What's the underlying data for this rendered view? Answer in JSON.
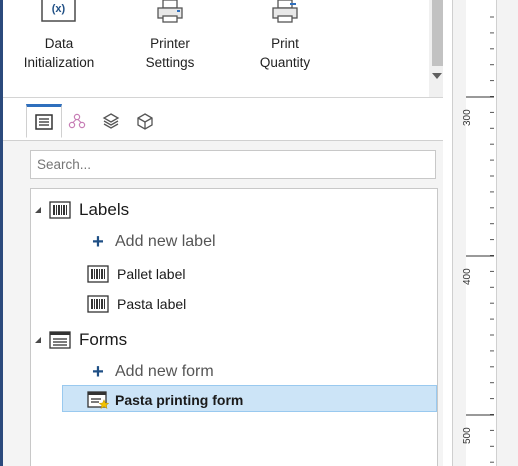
{
  "ribbon": {
    "buttons": [
      {
        "line1": "Data",
        "line2": "Initialization",
        "icon": "variable-icon"
      },
      {
        "line1": "Printer",
        "line2": "Settings",
        "icon": "printer-settings-icon"
      },
      {
        "line1": "Print",
        "line2": "Quantity",
        "icon": "print-quantity-icon"
      }
    ],
    "data_init_icon_text": "(x)"
  },
  "tabs": [
    {
      "name": "labels-forms",
      "icon": "list-icon",
      "active": true
    },
    {
      "name": "data-sources",
      "icon": "hierarchy-icon",
      "active": false
    },
    {
      "name": "layers",
      "icon": "layers-icon",
      "active": false
    },
    {
      "name": "objects",
      "icon": "cube-icon",
      "active": false
    }
  ],
  "search": {
    "placeholder": "Search..."
  },
  "tree": {
    "labels_group": "Labels",
    "add_label": "Add new label",
    "labels": [
      "Pallet label",
      "Pasta label"
    ],
    "forms_group": "Forms",
    "add_form": "Add new form",
    "forms": [
      "Pasta printing form"
    ]
  },
  "ruler": {
    "labels": [
      "300",
      "400",
      "500"
    ]
  },
  "colors": {
    "accent": "#2f6fbd",
    "plus": "#1f4f85",
    "selection": "#cce4f7",
    "selection_border": "#99c9ef",
    "left_border": "#2b4a7c"
  }
}
